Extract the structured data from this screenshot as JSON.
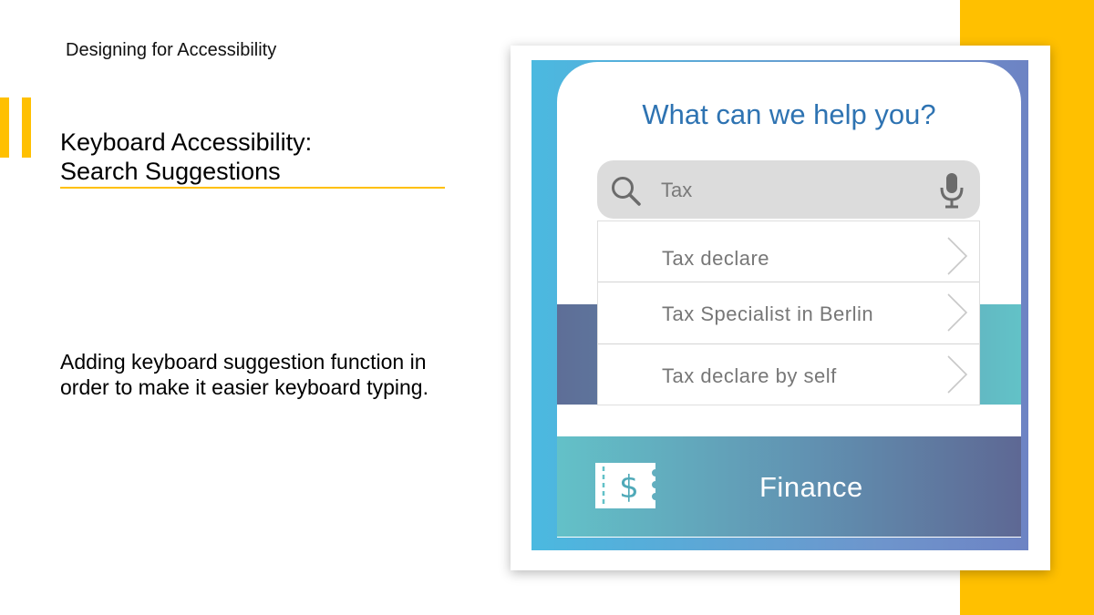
{
  "slide": {
    "kicker": "Designing for Accessibility",
    "title_line1": "Keyboard Accessibility:",
    "title_line2": "Search Suggestions",
    "body": "Adding keyboard suggestion function in order to make it easier keyboard typing."
  },
  "app": {
    "heading": "What can we help you?",
    "search": {
      "value": "Tax",
      "icon": "search-icon",
      "mic_icon": "microphone-icon"
    },
    "suggestions": [
      {
        "label": "Tax declare"
      },
      {
        "label": "Tax Specialist in Berlin"
      },
      {
        "label": "Tax declare by self"
      }
    ],
    "category": {
      "label": "Finance",
      "icon": "dollar-ticket-icon"
    }
  },
  "colors": {
    "accent": "#FFC000",
    "heading_blue": "#2E73B2",
    "search_bg": "#DCDCDC",
    "suggestion_text": "#777777"
  }
}
